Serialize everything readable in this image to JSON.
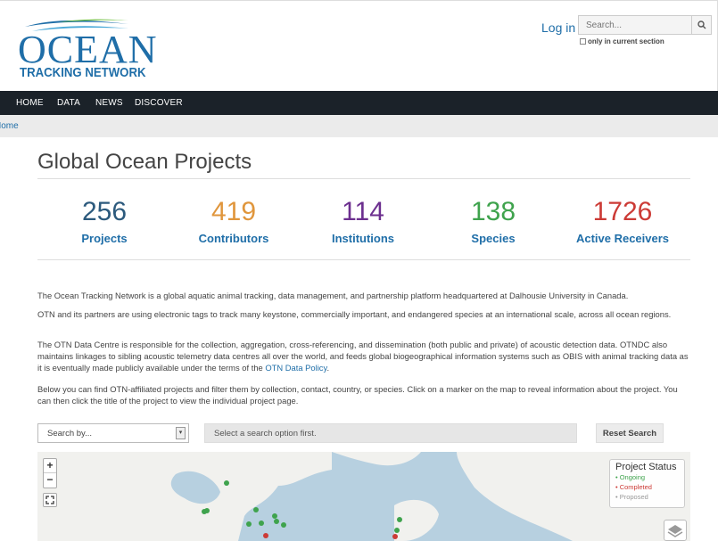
{
  "header": {
    "logo_top": "OCEAN",
    "logo_bottom": "TRACKING NETWORK",
    "login_label": "Log in",
    "search_placeholder": "Search...",
    "only_section_label": "only in current section",
    "icons": {
      "search": "search-icon"
    }
  },
  "nav": {
    "items": [
      {
        "label": "HOME"
      },
      {
        "label": "DATA"
      },
      {
        "label": "NEWS"
      },
      {
        "label": "DISCOVER"
      }
    ]
  },
  "breadcrumb": {
    "home": "Home"
  },
  "main": {
    "title": "Global Ocean Projects",
    "stats": [
      {
        "value": "256",
        "label": "Projects",
        "color": "#2c5a7d"
      },
      {
        "value": "419",
        "label": "Contributors",
        "color": "#e0963c"
      },
      {
        "value": "114",
        "label": "Institutions",
        "color": "#6c2f8f"
      },
      {
        "value": "138",
        "label": "Species",
        "color": "#3fa34d"
      },
      {
        "value": "1726",
        "label": "Active Receivers",
        "color": "#cc3b36"
      }
    ],
    "paragraphs": [
      "The Ocean Tracking Network is a global aquatic animal tracking, data management, and partnership platform headquartered at Dalhousie University in Canada.",
      "OTN and its partners are using electronic tags to track many keystone, commercially important, and endangered species at an international scale, across all ocean regions.",
      "The OTN Data Centre is responsible for the collection, aggregation, cross-referencing, and dissemination (both public and private) of acoustic detection data. OTNDC also maintains linkages to sibling acoustic telemetry data centres all over the world, and feeds global biogeographical information systems such as OBIS with animal tracking data as it is eventually made publicly available under the terms of the",
      "Below you can find OTN-affiliated projects and filter them by collection, contact, country, or species. Click on a marker on the map to reveal information about the project. You can then click the title of the project to view the individual project page."
    ],
    "policy_link": "OTN Data Policy",
    "policy_end": "."
  },
  "search": {
    "select_label": "Search by...",
    "option_placeholder": "Select a search option first.",
    "reset_label": "Reset Search"
  },
  "map": {
    "zoom_in": "+",
    "zoom_out": "−",
    "legend_title": "Project Status",
    "legend_items": [
      {
        "label": "• Ongoing",
        "color": "#3fa34d"
      },
      {
        "label": "• Completed",
        "color": "#cc3b36"
      },
      {
        "label": "• Proposed",
        "color": "#999999"
      }
    ],
    "land_color": "#f1f1ee",
    "water_color": "#b7d0e0"
  }
}
